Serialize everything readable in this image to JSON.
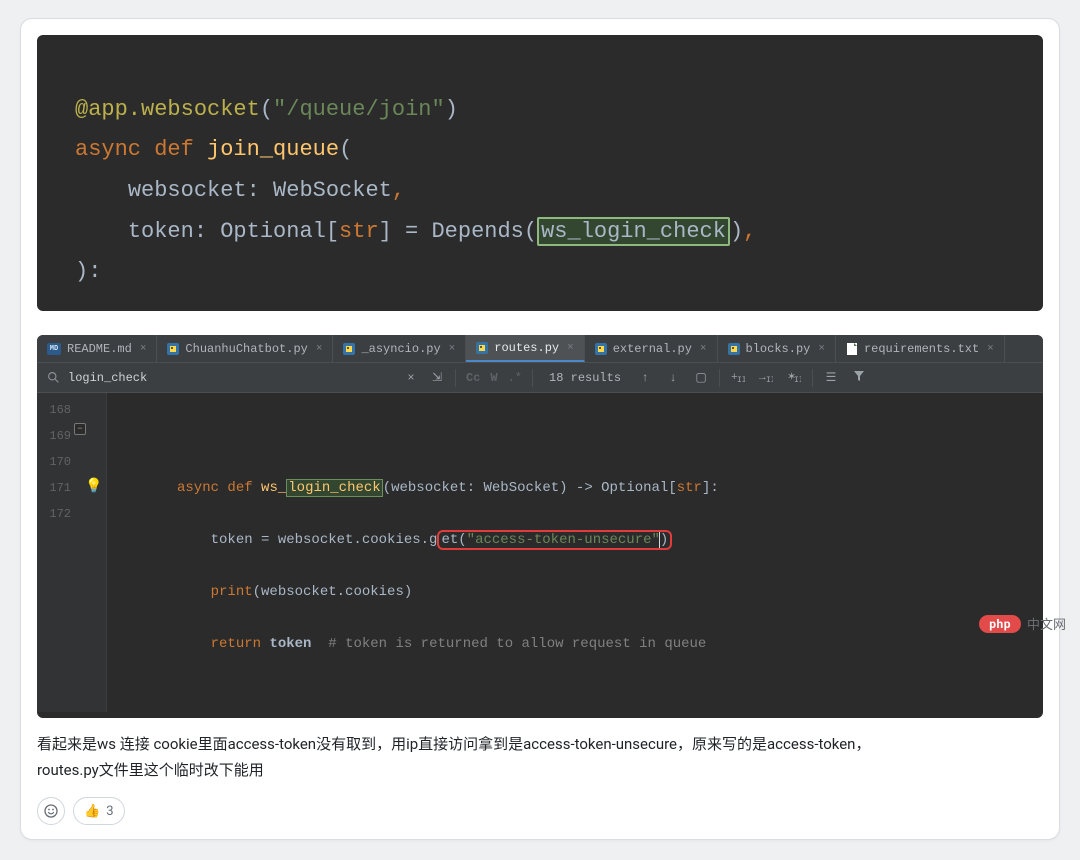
{
  "code1": {
    "l1_a": "@app.websocket",
    "l1_p": "(",
    "l1_s": "\"/queue/join\"",
    "l1_c": ")",
    "l2_a": "async",
    "l2_b": "def",
    "l2_c": "join_queue",
    "l2_p": "(",
    "l3_a": "websocket: WebSocket",
    "l3_c": ",",
    "l4_a": "token: Optional[",
    "l4_b": "str",
    "l4_c": "] = Depends(",
    "l4_h": "ws_login_check",
    "l4_d": ")",
    "l4_e": ",",
    "l5_a": "):"
  },
  "tabs": {
    "t0": "README.md",
    "t1": "ChuanhuChatbot.py",
    "t2": "_asyncio.py",
    "t3": "routes.py",
    "t4": "external.py",
    "t5": "blocks.py",
    "t6": "requirements.txt"
  },
  "search": {
    "query": "login_check",
    "cc": "Cc",
    "w": "W",
    "regex": ".*",
    "results": "18 results"
  },
  "lines": {
    "n0": "168",
    "n1": "169",
    "n2": "170",
    "n3": "171",
    "n4": "172"
  },
  "code2": {
    "r1_a": "async",
    "r1_b": "def",
    "r1_c": "ws_",
    "r1_h": "login_check",
    "r1_d": "(websocket: WebSocket) -> Optional[",
    "r1_e": "str",
    "r1_f": "]:",
    "r2_a": "token = websocket.cookies.g",
    "r2_b": "et(",
    "r2_c": "\"access-token-unsecure\"",
    "r2_d": ")",
    "r3_a": "print",
    "r3_b": "(websocket.cookies)",
    "r4_a": "return",
    "r4_b": "token",
    "r4_c": "# token is returned to allow request in queue"
  },
  "comment": {
    "line1": "看起来是ws 连接 cookie里面access-token没有取到，用ip直接访问拿到是access-token-unsecure，原来写的是access-token，",
    "line2": "routes.py文件里这个临时改下能用"
  },
  "reactions": {
    "thumb": "👍",
    "count": "3"
  },
  "brand": {
    "pill": "php",
    "text": "中文网"
  }
}
